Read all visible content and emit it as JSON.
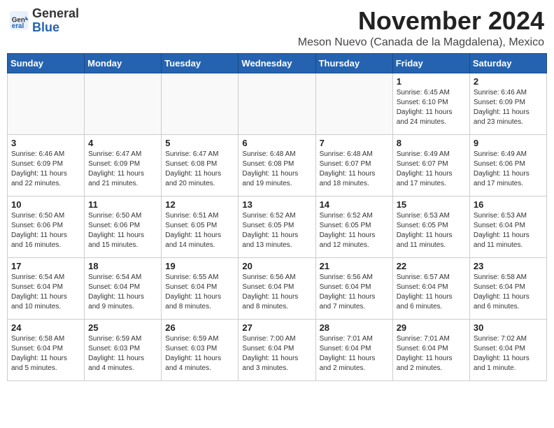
{
  "logo": {
    "general": "General",
    "blue": "Blue"
  },
  "title": "November 2024",
  "location": "Meson Nuevo (Canada de la Magdalena), Mexico",
  "weekdays": [
    "Sunday",
    "Monday",
    "Tuesday",
    "Wednesday",
    "Thursday",
    "Friday",
    "Saturday"
  ],
  "days": [
    {
      "num": "",
      "info": ""
    },
    {
      "num": "",
      "info": ""
    },
    {
      "num": "",
      "info": ""
    },
    {
      "num": "",
      "info": ""
    },
    {
      "num": "",
      "info": ""
    },
    {
      "num": "1",
      "info": "Sunrise: 6:45 AM\nSunset: 6:10 PM\nDaylight: 11 hours and 24 minutes."
    },
    {
      "num": "2",
      "info": "Sunrise: 6:46 AM\nSunset: 6:09 PM\nDaylight: 11 hours and 23 minutes."
    },
    {
      "num": "3",
      "info": "Sunrise: 6:46 AM\nSunset: 6:09 PM\nDaylight: 11 hours and 22 minutes."
    },
    {
      "num": "4",
      "info": "Sunrise: 6:47 AM\nSunset: 6:09 PM\nDaylight: 11 hours and 21 minutes."
    },
    {
      "num": "5",
      "info": "Sunrise: 6:47 AM\nSunset: 6:08 PM\nDaylight: 11 hours and 20 minutes."
    },
    {
      "num": "6",
      "info": "Sunrise: 6:48 AM\nSunset: 6:08 PM\nDaylight: 11 hours and 19 minutes."
    },
    {
      "num": "7",
      "info": "Sunrise: 6:48 AM\nSunset: 6:07 PM\nDaylight: 11 hours and 18 minutes."
    },
    {
      "num": "8",
      "info": "Sunrise: 6:49 AM\nSunset: 6:07 PM\nDaylight: 11 hours and 17 minutes."
    },
    {
      "num": "9",
      "info": "Sunrise: 6:49 AM\nSunset: 6:06 PM\nDaylight: 11 hours and 17 minutes."
    },
    {
      "num": "10",
      "info": "Sunrise: 6:50 AM\nSunset: 6:06 PM\nDaylight: 11 hours and 16 minutes."
    },
    {
      "num": "11",
      "info": "Sunrise: 6:50 AM\nSunset: 6:06 PM\nDaylight: 11 hours and 15 minutes."
    },
    {
      "num": "12",
      "info": "Sunrise: 6:51 AM\nSunset: 6:05 PM\nDaylight: 11 hours and 14 minutes."
    },
    {
      "num": "13",
      "info": "Sunrise: 6:52 AM\nSunset: 6:05 PM\nDaylight: 11 hours and 13 minutes."
    },
    {
      "num": "14",
      "info": "Sunrise: 6:52 AM\nSunset: 6:05 PM\nDaylight: 11 hours and 12 minutes."
    },
    {
      "num": "15",
      "info": "Sunrise: 6:53 AM\nSunset: 6:05 PM\nDaylight: 11 hours and 11 minutes."
    },
    {
      "num": "16",
      "info": "Sunrise: 6:53 AM\nSunset: 6:04 PM\nDaylight: 11 hours and 11 minutes."
    },
    {
      "num": "17",
      "info": "Sunrise: 6:54 AM\nSunset: 6:04 PM\nDaylight: 11 hours and 10 minutes."
    },
    {
      "num": "18",
      "info": "Sunrise: 6:54 AM\nSunset: 6:04 PM\nDaylight: 11 hours and 9 minutes."
    },
    {
      "num": "19",
      "info": "Sunrise: 6:55 AM\nSunset: 6:04 PM\nDaylight: 11 hours and 8 minutes."
    },
    {
      "num": "20",
      "info": "Sunrise: 6:56 AM\nSunset: 6:04 PM\nDaylight: 11 hours and 8 minutes."
    },
    {
      "num": "21",
      "info": "Sunrise: 6:56 AM\nSunset: 6:04 PM\nDaylight: 11 hours and 7 minutes."
    },
    {
      "num": "22",
      "info": "Sunrise: 6:57 AM\nSunset: 6:04 PM\nDaylight: 11 hours and 6 minutes."
    },
    {
      "num": "23",
      "info": "Sunrise: 6:58 AM\nSunset: 6:04 PM\nDaylight: 11 hours and 6 minutes."
    },
    {
      "num": "24",
      "info": "Sunrise: 6:58 AM\nSunset: 6:04 PM\nDaylight: 11 hours and 5 minutes."
    },
    {
      "num": "25",
      "info": "Sunrise: 6:59 AM\nSunset: 6:03 PM\nDaylight: 11 hours and 4 minutes."
    },
    {
      "num": "26",
      "info": "Sunrise: 6:59 AM\nSunset: 6:03 PM\nDaylight: 11 hours and 4 minutes."
    },
    {
      "num": "27",
      "info": "Sunrise: 7:00 AM\nSunset: 6:04 PM\nDaylight: 11 hours and 3 minutes."
    },
    {
      "num": "28",
      "info": "Sunrise: 7:01 AM\nSunset: 6:04 PM\nDaylight: 11 hours and 2 minutes."
    },
    {
      "num": "29",
      "info": "Sunrise: 7:01 AM\nSunset: 6:04 PM\nDaylight: 11 hours and 2 minutes."
    },
    {
      "num": "30",
      "info": "Sunrise: 7:02 AM\nSunset: 6:04 PM\nDaylight: 11 hours and 1 minute."
    }
  ]
}
